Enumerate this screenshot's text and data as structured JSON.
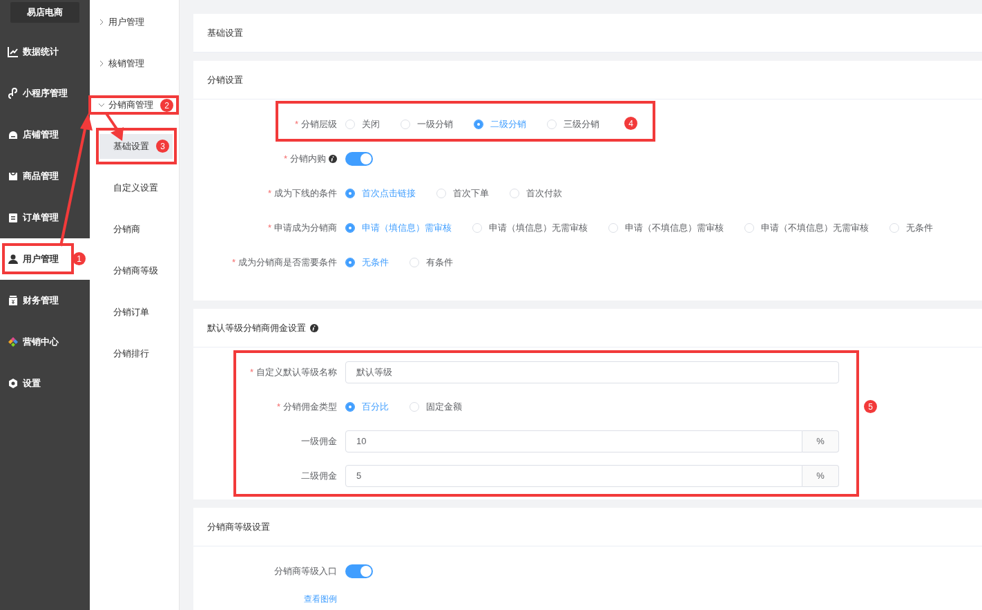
{
  "brand": "易店电商",
  "sidebar": {
    "items": [
      {
        "label": "数据统计",
        "selected": false
      },
      {
        "label": "小程序管理",
        "selected": false
      },
      {
        "label": "店铺管理",
        "selected": false
      },
      {
        "label": "商品管理",
        "selected": false
      },
      {
        "label": "订单管理",
        "selected": false
      },
      {
        "label": "用户管理",
        "selected": true
      },
      {
        "label": "财务管理",
        "selected": false
      },
      {
        "label": "营销中心",
        "selected": false
      },
      {
        "label": "设置",
        "selected": false
      }
    ]
  },
  "submenu": {
    "items": [
      {
        "label": "用户管理",
        "expanded": false
      },
      {
        "label": "核销管理",
        "expanded": false
      },
      {
        "label": "分销商管理",
        "expanded": true,
        "children": [
          {
            "label": "基础设置",
            "selected": true
          },
          {
            "label": "自定义设置",
            "selected": false
          },
          {
            "label": "分销商",
            "selected": false
          },
          {
            "label": "分销商等级",
            "selected": false
          },
          {
            "label": "分销订单",
            "selected": false
          },
          {
            "label": "分销排行",
            "selected": false
          }
        ]
      }
    ]
  },
  "cards": [
    {
      "title": "基础设置"
    },
    {
      "title": "分销设置",
      "rows": [
        {
          "kind": "radio",
          "required_mark": "*",
          "label": "分销层级",
          "options": [
            {
              "label": "关闭",
              "selected": false
            },
            {
              "label": "一级分销",
              "selected": false
            },
            {
              "label": "二级分销",
              "selected": true
            },
            {
              "label": "三级分销",
              "selected": false
            }
          ]
        },
        {
          "kind": "switch",
          "required_mark": "*",
          "label": "分销内购",
          "info": true,
          "on": true
        },
        {
          "kind": "radio",
          "required_mark": "*",
          "label": "成为下线的条件",
          "options": [
            {
              "label": "首次点击链接",
              "selected": true
            },
            {
              "label": "首次下单",
              "selected": false
            },
            {
              "label": "首次付款",
              "selected": false
            }
          ]
        },
        {
          "kind": "radio",
          "required_mark": "*",
          "label": "申请成为分销商",
          "options": [
            {
              "label": "申请（填信息）需审核",
              "selected": true
            },
            {
              "label": "申请（填信息）无需审核",
              "selected": false
            },
            {
              "label": "申请（不填信息）需审核",
              "selected": false
            },
            {
              "label": "申请（不填信息）无需审核",
              "selected": false
            },
            {
              "label": "无条件",
              "selected": false
            }
          ]
        },
        {
          "kind": "radio",
          "required_mark": "*",
          "label": "成为分销商是否需要条件",
          "options": [
            {
              "label": "无条件",
              "selected": true
            },
            {
              "label": "有条件",
              "selected": false
            }
          ]
        }
      ]
    },
    {
      "title": "默认等级分销商佣金设置",
      "info": true,
      "rows": [
        {
          "kind": "input",
          "required_mark": "*",
          "label": "自定义默认等级名称",
          "value": "默认等级"
        },
        {
          "kind": "radio",
          "required_mark": "*",
          "label": "分销佣金类型",
          "options": [
            {
              "label": "百分比",
              "selected": true
            },
            {
              "label": "固定金额",
              "selected": false
            }
          ]
        },
        {
          "kind": "input_append",
          "label": "一级佣金",
          "value": "10",
          "append": "%"
        },
        {
          "kind": "input_append",
          "label": "二级佣金",
          "value": "5",
          "append": "%"
        }
      ]
    },
    {
      "title": "分销商等级设置",
      "rows": [
        {
          "kind": "switch",
          "label": "分销商等级入口",
          "on": true
        },
        {
          "kind": "link",
          "text": "查看图例"
        }
      ]
    }
  ],
  "annotations": [
    {
      "number": "1"
    },
    {
      "number": "2"
    },
    {
      "number": "3"
    },
    {
      "number": "4"
    },
    {
      "number": "5"
    }
  ]
}
